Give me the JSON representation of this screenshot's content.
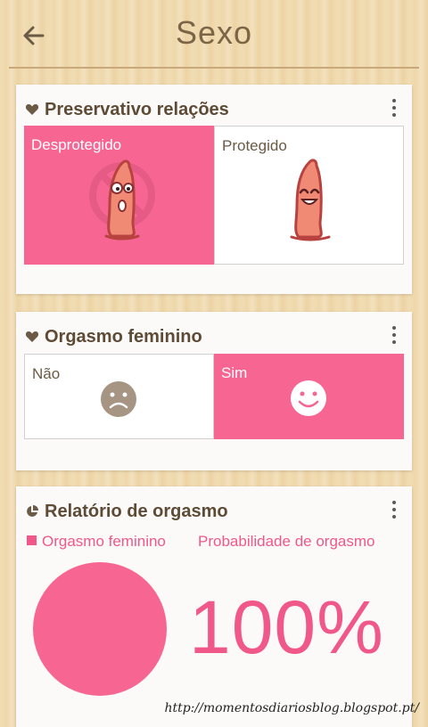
{
  "header": {
    "title": "Sexo",
    "back_icon": "arrow-left-icon"
  },
  "cards": {
    "condom": {
      "title": "Preservativo relações",
      "icon": "heart-icon",
      "options": [
        {
          "label": "Desprotegido",
          "selected": true,
          "icon": "condom-forbidden-icon"
        },
        {
          "label": "Protegido",
          "selected": false,
          "icon": "condom-happy-icon"
        }
      ]
    },
    "orgasm": {
      "title": "Orgasmo feminino",
      "icon": "heart-icon",
      "options": [
        {
          "label": "Não",
          "selected": false,
          "icon": "sad-face-icon"
        },
        {
          "label": "Sim",
          "selected": true,
          "icon": "smiley-face-icon"
        }
      ]
    },
    "report": {
      "title": "Relatório de orgasmo",
      "icon": "pie-chart-icon",
      "legend": "Orgasmo feminino",
      "probability_label": "Probabilidade de orgasmo",
      "percent": "100%"
    }
  },
  "chart_data": {
    "type": "pie",
    "categories": [
      "Orgasmo feminino"
    ],
    "values": [
      100
    ]
  },
  "colors": {
    "accent": "#f76692",
    "text_brown": "#5e4b36",
    "title_brown": "#7b6546"
  },
  "watermark": "http://momentosdiariosblog.blogspot.pt/"
}
